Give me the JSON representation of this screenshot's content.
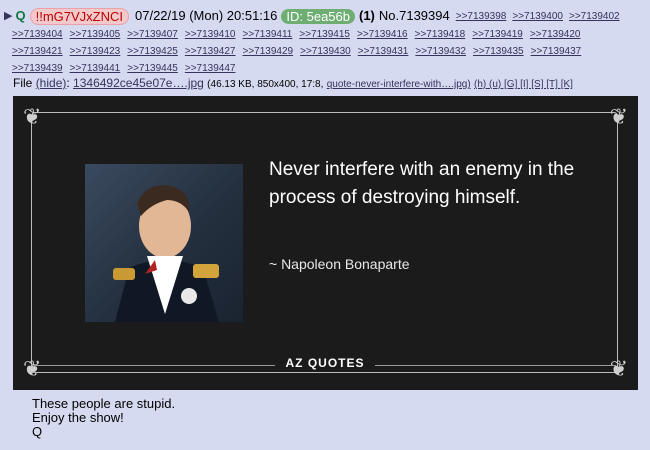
{
  "post": {
    "arrow_icon": "triangle-right-icon",
    "name": "Q",
    "tripcode": "!!mG7VJxZNCI",
    "datetime": "07/22/19 (Mon) 20:51:16",
    "id_label": "ID: 5ea56b",
    "reply_count": "(1)",
    "post_number": "No.7139394",
    "quote_links_row1": [
      ">>7139398",
      ">>7139400",
      ">>7139402"
    ],
    "backlinks_row2": [
      ">>7139404",
      ">>7139405",
      ">>7139407",
      ">>7139410",
      ">>7139411",
      ">>7139415",
      ">>7139416",
      ">>7139418",
      ">>7139419",
      ">>7139420"
    ],
    "backlinks_row3": [
      ">>7139421",
      ">>7139423",
      ">>7139425",
      ">>7139427",
      ">>7139429",
      ">>7139430",
      ">>7139431",
      ">>7139432",
      ">>7139435",
      ">>7139437"
    ],
    "backlinks_row4": [
      ">>7139439",
      ">>7139441",
      ">>7139445",
      ">>7139447"
    ],
    "file": {
      "label": "File",
      "hide": "(hide)",
      "filename": "1346492ce45e07e….jpg",
      "meta": "(46.13 KB, 850x400, 17:8,",
      "orig_name": "quote-never-interfere-with….jpg)",
      "actions": "(h) (u) [G] [I] [S] [T] [K]"
    },
    "image": {
      "quote": "Never interfere with an enemy in the process of destroying himself.",
      "author": "~ Napoleon Bonaparte",
      "logo": "AZ QUOTES"
    },
    "message": [
      "These people are stupid.",
      "Enjoy the show!",
      "Q"
    ]
  }
}
